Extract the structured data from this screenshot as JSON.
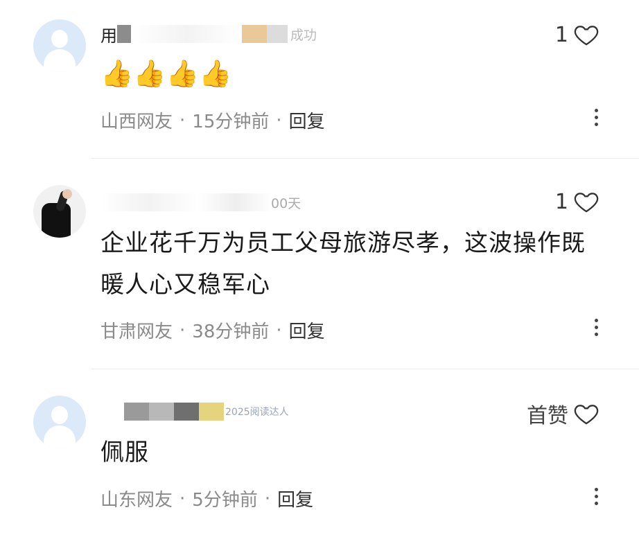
{
  "comments": [
    {
      "username": "用",
      "badge": "成功",
      "likes": "1",
      "content": "👍👍👍👍",
      "location": "山西网友",
      "time": "15分钟前",
      "reply": "回复"
    },
    {
      "username": "",
      "badge": "00天",
      "likes": "1",
      "content": "企业花千万为员工父母旅游尽孝，这波操作既暖人心又稳军心",
      "location": "甘肃网友",
      "time": "38分钟前",
      "reply": "回复"
    },
    {
      "username": "",
      "badge": "2025阅读达人",
      "likes": "首赞",
      "content": "佩服",
      "location": "山东网友",
      "time": "5分钟前",
      "reply": "回复"
    }
  ],
  "separator": "·",
  "icons": {
    "like": "heart-outline-icon",
    "more": "more-vertical-icon"
  },
  "colors": {
    "avatar_bg": "#dbe9f9",
    "meta_text": "#8a8a8a",
    "divider": "#ececec"
  }
}
